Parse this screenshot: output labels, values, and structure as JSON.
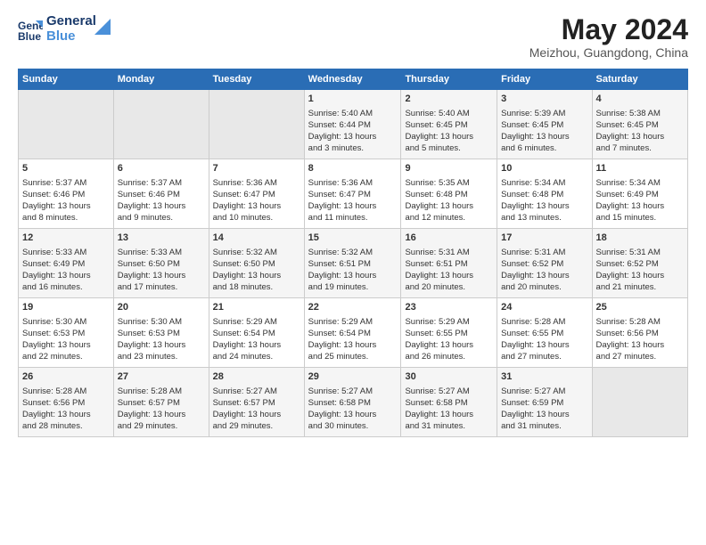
{
  "logo": {
    "line1": "General",
    "line2": "Blue"
  },
  "title": "May 2024",
  "location": "Meizhou, Guangdong, China",
  "weekdays": [
    "Sunday",
    "Monday",
    "Tuesday",
    "Wednesday",
    "Thursday",
    "Friday",
    "Saturday"
  ],
  "weeks": [
    [
      {
        "day": "",
        "data": ""
      },
      {
        "day": "",
        "data": ""
      },
      {
        "day": "",
        "data": ""
      },
      {
        "day": "1",
        "data": "Sunrise: 5:40 AM\nSunset: 6:44 PM\nDaylight: 13 hours\nand 3 minutes."
      },
      {
        "day": "2",
        "data": "Sunrise: 5:40 AM\nSunset: 6:45 PM\nDaylight: 13 hours\nand 5 minutes."
      },
      {
        "day": "3",
        "data": "Sunrise: 5:39 AM\nSunset: 6:45 PM\nDaylight: 13 hours\nand 6 minutes."
      },
      {
        "day": "4",
        "data": "Sunrise: 5:38 AM\nSunset: 6:45 PM\nDaylight: 13 hours\nand 7 minutes."
      }
    ],
    [
      {
        "day": "5",
        "data": "Sunrise: 5:37 AM\nSunset: 6:46 PM\nDaylight: 13 hours\nand 8 minutes."
      },
      {
        "day": "6",
        "data": "Sunrise: 5:37 AM\nSunset: 6:46 PM\nDaylight: 13 hours\nand 9 minutes."
      },
      {
        "day": "7",
        "data": "Sunrise: 5:36 AM\nSunset: 6:47 PM\nDaylight: 13 hours\nand 10 minutes."
      },
      {
        "day": "8",
        "data": "Sunrise: 5:36 AM\nSunset: 6:47 PM\nDaylight: 13 hours\nand 11 minutes."
      },
      {
        "day": "9",
        "data": "Sunrise: 5:35 AM\nSunset: 6:48 PM\nDaylight: 13 hours\nand 12 minutes."
      },
      {
        "day": "10",
        "data": "Sunrise: 5:34 AM\nSunset: 6:48 PM\nDaylight: 13 hours\nand 13 minutes."
      },
      {
        "day": "11",
        "data": "Sunrise: 5:34 AM\nSunset: 6:49 PM\nDaylight: 13 hours\nand 15 minutes."
      }
    ],
    [
      {
        "day": "12",
        "data": "Sunrise: 5:33 AM\nSunset: 6:49 PM\nDaylight: 13 hours\nand 16 minutes."
      },
      {
        "day": "13",
        "data": "Sunrise: 5:33 AM\nSunset: 6:50 PM\nDaylight: 13 hours\nand 17 minutes."
      },
      {
        "day": "14",
        "data": "Sunrise: 5:32 AM\nSunset: 6:50 PM\nDaylight: 13 hours\nand 18 minutes."
      },
      {
        "day": "15",
        "data": "Sunrise: 5:32 AM\nSunset: 6:51 PM\nDaylight: 13 hours\nand 19 minutes."
      },
      {
        "day": "16",
        "data": "Sunrise: 5:31 AM\nSunset: 6:51 PM\nDaylight: 13 hours\nand 20 minutes."
      },
      {
        "day": "17",
        "data": "Sunrise: 5:31 AM\nSunset: 6:52 PM\nDaylight: 13 hours\nand 20 minutes."
      },
      {
        "day": "18",
        "data": "Sunrise: 5:31 AM\nSunset: 6:52 PM\nDaylight: 13 hours\nand 21 minutes."
      }
    ],
    [
      {
        "day": "19",
        "data": "Sunrise: 5:30 AM\nSunset: 6:53 PM\nDaylight: 13 hours\nand 22 minutes."
      },
      {
        "day": "20",
        "data": "Sunrise: 5:30 AM\nSunset: 6:53 PM\nDaylight: 13 hours\nand 23 minutes."
      },
      {
        "day": "21",
        "data": "Sunrise: 5:29 AM\nSunset: 6:54 PM\nDaylight: 13 hours\nand 24 minutes."
      },
      {
        "day": "22",
        "data": "Sunrise: 5:29 AM\nSunset: 6:54 PM\nDaylight: 13 hours\nand 25 minutes."
      },
      {
        "day": "23",
        "data": "Sunrise: 5:29 AM\nSunset: 6:55 PM\nDaylight: 13 hours\nand 26 minutes."
      },
      {
        "day": "24",
        "data": "Sunrise: 5:28 AM\nSunset: 6:55 PM\nDaylight: 13 hours\nand 27 minutes."
      },
      {
        "day": "25",
        "data": "Sunrise: 5:28 AM\nSunset: 6:56 PM\nDaylight: 13 hours\nand 27 minutes."
      }
    ],
    [
      {
        "day": "26",
        "data": "Sunrise: 5:28 AM\nSunset: 6:56 PM\nDaylight: 13 hours\nand 28 minutes."
      },
      {
        "day": "27",
        "data": "Sunrise: 5:28 AM\nSunset: 6:57 PM\nDaylight: 13 hours\nand 29 minutes."
      },
      {
        "day": "28",
        "data": "Sunrise: 5:27 AM\nSunset: 6:57 PM\nDaylight: 13 hours\nand 29 minutes."
      },
      {
        "day": "29",
        "data": "Sunrise: 5:27 AM\nSunset: 6:58 PM\nDaylight: 13 hours\nand 30 minutes."
      },
      {
        "day": "30",
        "data": "Sunrise: 5:27 AM\nSunset: 6:58 PM\nDaylight: 13 hours\nand 31 minutes."
      },
      {
        "day": "31",
        "data": "Sunrise: 5:27 AM\nSunset: 6:59 PM\nDaylight: 13 hours\nand 31 minutes."
      },
      {
        "day": "",
        "data": ""
      }
    ]
  ]
}
